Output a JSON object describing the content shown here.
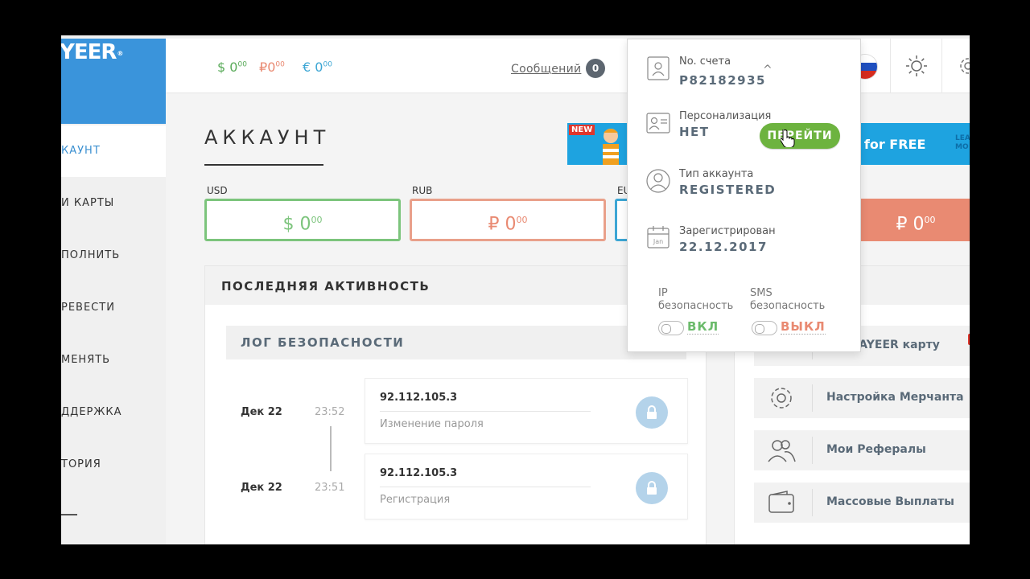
{
  "sidebar": {
    "logo": "YEER",
    "logo_mark": "®",
    "items": [
      {
        "label": "КАУНТ"
      },
      {
        "label": "И КАРТЫ"
      },
      {
        "label": "ПОЛНИТЬ"
      },
      {
        "label": "РЕВЕСТИ"
      },
      {
        "label": "МЕНЯТЬ"
      },
      {
        "label": "ДДЕРЖКА"
      },
      {
        "label": "ТОРИЯ"
      }
    ]
  },
  "topbar": {
    "balances": [
      {
        "symbol": "$",
        "amount": "0",
        "cents": "00",
        "color": "#5aab5a"
      },
      {
        "symbol": "₽",
        "amount": "0",
        "cents": "00",
        "color": "#e98a72"
      },
      {
        "symbol": "€",
        "amount": "0",
        "cents": "00",
        "color": "#3ca6d4"
      }
    ],
    "messages_label": "Сообщений",
    "messages_count": "0"
  },
  "main": {
    "title": "АККАУНТ",
    "promo": {
      "badge": "NEW",
      "text": "ne, for FREE",
      "learn_1": "LEA",
      "learn_2": "MO"
    },
    "accounts": [
      {
        "label": "USD",
        "symbol": "$",
        "amount": "0",
        "cents": "00",
        "color": "#6cbb6c"
      },
      {
        "label": "RUB",
        "symbol": "₽",
        "amount": "0",
        "cents": "00",
        "color": "#e98a72"
      },
      {
        "label": "EU",
        "symbol": "",
        "amount": "",
        "cents": "",
        "color": "#3ca6d4"
      }
    ],
    "hidden_box": {
      "symbol": "₽",
      "amount": "0",
      "cents": "00"
    },
    "activity_title": "ПОСЛЕДНЯЯ АКТИВНОСТЬ",
    "security_log_title": "ЛОГ БЕЗОПАСНОСТИ",
    "log": [
      {
        "date": "Дек 22",
        "time": "23:52",
        "ip": "92.112.105.3",
        "desc": "Изменение пароля"
      },
      {
        "date": "Дек 22",
        "time": "23:51",
        "ip": "92.112.105.3",
        "desc": "Регистрация"
      }
    ],
    "quick_links": [
      {
        "label": "ать PAYEER карту",
        "icon": "card-icon"
      },
      {
        "label": "Настройка Мерчанта",
        "icon": "gear-icon"
      },
      {
        "label": "Мои Рефералы",
        "icon": "users-icon"
      },
      {
        "label": "Массовые Выплаты",
        "icon": "wallet-icon"
      }
    ]
  },
  "dropdown": {
    "account_label": "No. счета",
    "account_number": "P82182935",
    "caret": "^",
    "personalization_label": "Персонализация",
    "personalization_value": "НЕТ",
    "go_button": "ПЕРЕЙТИ",
    "type_label": "Тип аккаунта",
    "type_value": "REGISTERED",
    "registered_label": "Зарегистрирован",
    "registered_value": "22.12.2017",
    "calendar_month": "Jan",
    "ip_security_1": "IP",
    "ip_security_2": "безопасность",
    "ip_security_state": "ВКЛ",
    "sms_security_1": "SMS",
    "sms_security_2": "безопасность",
    "sms_security_state": "ВЫКЛ"
  }
}
